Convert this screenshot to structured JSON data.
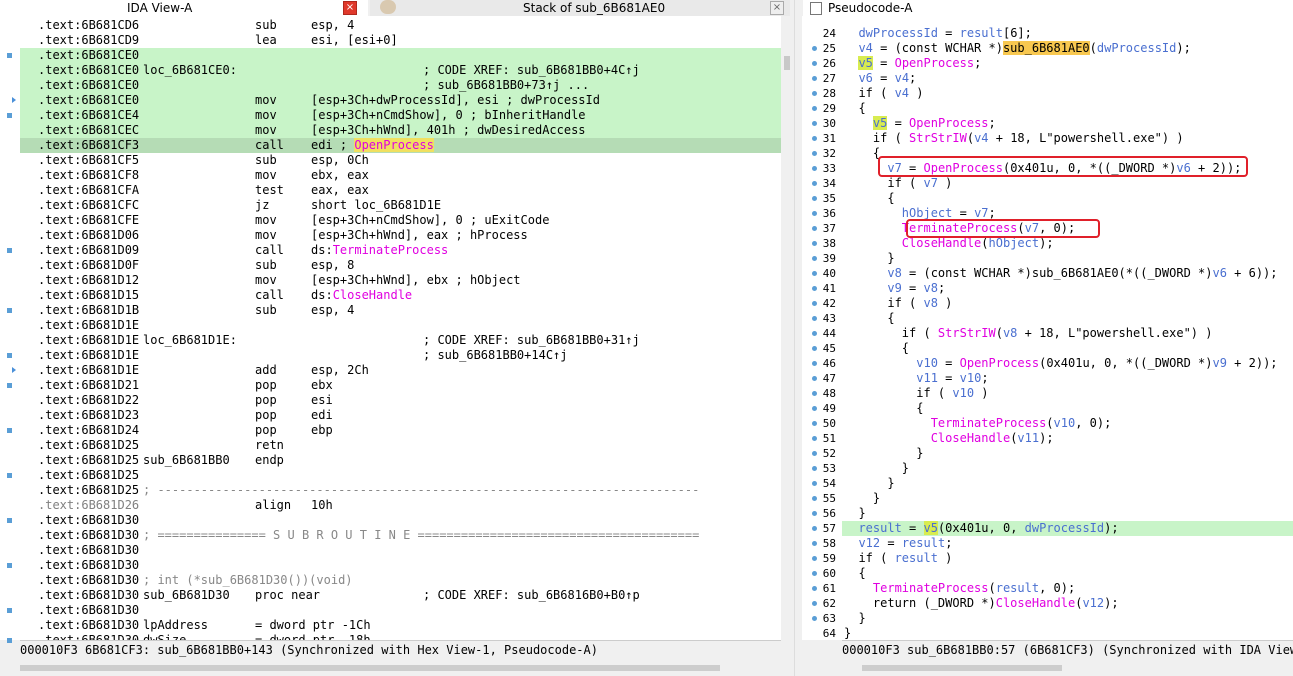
{
  "tabs": {
    "ida_view": "IDA View-A",
    "stack": "Stack of sub_6B681AE0",
    "pseudocode": "Pseudocode-A",
    "close": "×"
  },
  "ida": {
    "rows": [
      {
        "addr": ".text:6B681CD6",
        "label": "",
        "mnem": "sub",
        "ops": "esp, 4",
        "cmt": ""
      },
      {
        "addr": ".text:6B681CD9",
        "label": "",
        "mnem": "lea",
        "ops": "esi, [esi+0]",
        "cmt": ""
      },
      {
        "addr": ".text:6B681CE0",
        "label": "",
        "mnem": "",
        "ops": "",
        "cmt": ""
      },
      {
        "addr": ".text:6B681CE0",
        "label": "loc_6B681CE0:",
        "mnem": "",
        "ops": "",
        "cmt": "; CODE XREF: sub_6B681BB0+4C↑j"
      },
      {
        "addr": ".text:6B681CE0",
        "label": "",
        "mnem": "",
        "ops": "",
        "cmt": "; sub_6B681BB0+73↑j ..."
      },
      {
        "addr": ".text:6B681CE0",
        "label": "",
        "mnem": "mov",
        "ops": "[esp+3Ch+dwProcessId], esi ; dwProcessId",
        "cmt": ""
      },
      {
        "addr": ".text:6B681CE4",
        "label": "",
        "mnem": "mov",
        "ops": "[esp+3Ch+nCmdShow], 0 ; bInheritHandle",
        "cmt": ""
      },
      {
        "addr": ".text:6B681CEC",
        "label": "",
        "mnem": "mov",
        "ops": "[esp+3Ch+hWnd], 401h ; dwDesiredAccess",
        "cmt": ""
      },
      {
        "addr": ".text:6B681CF3",
        "label": "",
        "mnem": "call",
        "ops": "edi ; ",
        "pk": "OpenProcess",
        "cmt": ""
      },
      {
        "addr": ".text:6B681CF5",
        "label": "",
        "mnem": "sub",
        "ops": "esp, 0Ch",
        "cmt": ""
      },
      {
        "addr": ".text:6B681CF8",
        "label": "",
        "mnem": "mov",
        "ops": "ebx, eax",
        "cmt": ""
      },
      {
        "addr": ".text:6B681CFA",
        "label": "",
        "mnem": "test",
        "ops": "eax, eax",
        "cmt": ""
      },
      {
        "addr": ".text:6B681CFC",
        "label": "",
        "mnem": "jz",
        "ops": "short loc_6B681D1E",
        "cmt": ""
      },
      {
        "addr": ".text:6B681CFE",
        "label": "",
        "mnem": "mov",
        "ops": "[esp+3Ch+nCmdShow], 0 ; uExitCode",
        "cmt": ""
      },
      {
        "addr": ".text:6B681D06",
        "label": "",
        "mnem": "mov",
        "ops": "[esp+3Ch+hWnd], eax ; hProcess",
        "cmt": ""
      },
      {
        "addr": ".text:6B681D09",
        "label": "",
        "mnem": "call",
        "ops": "ds:",
        "pk": "TerminateProcess",
        "cmt": ""
      },
      {
        "addr": ".text:6B681D0F",
        "label": "",
        "mnem": "sub",
        "ops": "esp, 8",
        "cmt": ""
      },
      {
        "addr": ".text:6B681D12",
        "label": "",
        "mnem": "mov",
        "ops": "[esp+3Ch+hWnd], ebx ; hObject",
        "cmt": ""
      },
      {
        "addr": ".text:6B681D15",
        "label": "",
        "mnem": "call",
        "ops": "ds:",
        "pk": "CloseHandle",
        "cmt": ""
      },
      {
        "addr": ".text:6B681D1B",
        "label": "",
        "mnem": "sub",
        "ops": "esp, 4",
        "cmt": ""
      },
      {
        "addr": ".text:6B681D1E",
        "label": "",
        "mnem": "",
        "ops": "",
        "cmt": ""
      },
      {
        "addr": ".text:6B681D1E",
        "label": "loc_6B681D1E:",
        "mnem": "",
        "ops": "",
        "cmt": "; CODE XREF: sub_6B681BB0+31↑j"
      },
      {
        "addr": ".text:6B681D1E",
        "label": "",
        "mnem": "",
        "ops": "",
        "cmt": "; sub_6B681BB0+14C↑j"
      },
      {
        "addr": ".text:6B681D1E",
        "label": "",
        "mnem": "add",
        "ops": "esp, 2Ch",
        "cmt": ""
      },
      {
        "addr": ".text:6B681D21",
        "label": "",
        "mnem": "pop",
        "ops": "ebx",
        "cmt": ""
      },
      {
        "addr": ".text:6B681D22",
        "label": "",
        "mnem": "pop",
        "ops": "esi",
        "cmt": ""
      },
      {
        "addr": ".text:6B681D23",
        "label": "",
        "mnem": "pop",
        "ops": "edi",
        "cmt": ""
      },
      {
        "addr": ".text:6B681D24",
        "label": "",
        "mnem": "pop",
        "ops": "ebp",
        "cmt": ""
      },
      {
        "addr": ".text:6B681D25",
        "label": "",
        "mnem": "retn",
        "ops": "",
        "cmt": ""
      },
      {
        "addr": ".text:6B681D25",
        "label": "sub_6B681BB0",
        "mnem": "endp",
        "ops": "",
        "cmt": ""
      },
      {
        "addr": ".text:6B681D25",
        "label": "",
        "mnem": "",
        "ops": "",
        "cmt": ""
      },
      {
        "addr": ".text:6B681D25",
        "label": "",
        "mnem": "",
        "ops": "",
        "cmt": "",
        "gray": "; ---------------------------------------------------------------------------"
      },
      {
        "addr": ".text:6B681D26",
        "label": "",
        "mnem": "align",
        "ops": "10h",
        "cmt": "",
        "addr_gray": true
      },
      {
        "addr": ".text:6B681D30",
        "label": "",
        "mnem": "",
        "ops": "",
        "cmt": ""
      },
      {
        "addr": ".text:6B681D30",
        "label": "",
        "mnem": "",
        "ops": "",
        "cmt": "",
        "gray": "; =============== S U B R O U T I N E ======================================="
      },
      {
        "addr": ".text:6B681D30",
        "label": "",
        "mnem": "",
        "ops": "",
        "cmt": ""
      },
      {
        "addr": ".text:6B681D30",
        "label": "",
        "mnem": "",
        "ops": "",
        "cmt": ""
      },
      {
        "addr": ".text:6B681D30",
        "label": "",
        "mnem": "",
        "ops": "",
        "cmt": "",
        "gray": "; int (*sub_6B681D30())(void)"
      },
      {
        "addr": ".text:6B681D30",
        "label": "sub_6B681D30",
        "mnem": "proc near",
        "ops": "",
        "cmt": "; CODE XREF: sub_6B6816B0+B0↑p"
      },
      {
        "addr": ".text:6B681D30",
        "label": "",
        "mnem": "",
        "ops": "",
        "cmt": ""
      },
      {
        "addr": ".text:6B681D30",
        "label": "lpAddress",
        "mnem": "= dword ptr -1Ch",
        "ops": "",
        "cmt": ""
      },
      {
        "addr": ".text:6B681D30",
        "label": "dwSize",
        "mnem": "= dword ptr -18h",
        "ops": "",
        "cmt": ""
      }
    ],
    "status": "000010F3 6B681CF3: sub_6B681BB0+143 (Synchronized with Hex View-1, Pseudocode-A)"
  },
  "pseudo": {
    "lines": [
      {
        "n": "24",
        "html": "  <span class=\"bl\">dwProcessId</span> = <span class=\"bl\">result</span>[6];"
      },
      {
        "n": "25",
        "html": "  <span class=\"bl\">v4</span> = (const WCHAR *)<span class=\"ybg2\">sub_6B681AE0</span>(<span class=\"bl\">dwProcessId</span>);"
      },
      {
        "n": "26",
        "html": "  <span class=\"ygreen bl\">v5</span> = <span class=\"mg\">OpenProcess</span>;"
      },
      {
        "n": "27",
        "html": "  <span class=\"bl\">v6</span> = <span class=\"bl\">v4</span>;"
      },
      {
        "n": "28",
        "html": "  if ( <span class=\"bl\">v4</span> )"
      },
      {
        "n": "29",
        "html": "  {"
      },
      {
        "n": "30",
        "html": "    <span class=\"ygreen bl\">v5</span> = <span class=\"mg\">OpenProcess</span>;"
      },
      {
        "n": "31",
        "html": "    if ( <span class=\"mg\">StrStrIW</span>(<span class=\"bl\">v4</span> + 18, L\"powershell.exe\") )"
      },
      {
        "n": "32",
        "html": "    {"
      },
      {
        "n": "33",
        "html": "      <span class=\"bl\">v7</span> = <span class=\"mg\">OpenProcess</span>(0x401u, 0, *((_DWORD *)<span class=\"bl\">v6</span> + 2));"
      },
      {
        "n": "34",
        "html": "      if ( <span class=\"bl\">v7</span> )"
      },
      {
        "n": "35",
        "html": "      {"
      },
      {
        "n": "36",
        "html": "        <span class=\"bl\">hObject</span> = <span class=\"bl\">v7</span>;"
      },
      {
        "n": "37",
        "html": "        <span class=\"mg\">TerminateProcess</span>(<span class=\"bl\">v7</span>, 0);"
      },
      {
        "n": "38",
        "html": "        <span class=\"mg\">CloseHandle</span>(<span class=\"bl\">hObject</span>);"
      },
      {
        "n": "39",
        "html": "      }"
      },
      {
        "n": "40",
        "html": "      <span class=\"bl\">v8</span> = (const WCHAR *)sub_6B681AE0(*((_DWORD *)<span class=\"bl\">v6</span> + 6));"
      },
      {
        "n": "41",
        "html": "      <span class=\"bl\">v9</span> = <span class=\"bl\">v8</span>;"
      },
      {
        "n": "42",
        "html": "      if ( <span class=\"bl\">v8</span> )"
      },
      {
        "n": "43",
        "html": "      {"
      },
      {
        "n": "44",
        "html": "        if ( <span class=\"mg\">StrStrIW</span>(<span class=\"bl\">v8</span> + 18, L\"powershell.exe\") )"
      },
      {
        "n": "45",
        "html": "        {"
      },
      {
        "n": "46",
        "html": "          <span class=\"bl\">v10</span> = <span class=\"mg\">OpenProcess</span>(0x401u, 0, *((_DWORD *)<span class=\"bl\">v9</span> + 2));"
      },
      {
        "n": "47",
        "html": "          <span class=\"bl\">v11</span> = <span class=\"bl\">v10</span>;"
      },
      {
        "n": "48",
        "html": "          if ( <span class=\"bl\">v10</span> )"
      },
      {
        "n": "49",
        "html": "          {"
      },
      {
        "n": "50",
        "html": "            <span class=\"mg\">TerminateProcess</span>(<span class=\"bl\">v10</span>, 0);"
      },
      {
        "n": "51",
        "html": "            <span class=\"mg\">CloseHandle</span>(<span class=\"bl\">v11</span>);"
      },
      {
        "n": "52",
        "html": "          }"
      },
      {
        "n": "53",
        "html": "        }"
      },
      {
        "n": "54",
        "html": "      }"
      },
      {
        "n": "55",
        "html": "    }"
      },
      {
        "n": "56",
        "html": "  }"
      },
      {
        "n": "57",
        "html": "  <span class=\"bl\">result</span> = <span class=\"ygreen bl\">v5</span>(0x401u, 0, <span class=\"bl\">dwProcessId</span>);",
        "hl": true
      },
      {
        "n": "58",
        "html": "  <span class=\"bl\">v12</span> = <span class=\"bl\">result</span>;"
      },
      {
        "n": "59",
        "html": "  if ( <span class=\"bl\">result</span> )"
      },
      {
        "n": "60",
        "html": "  {"
      },
      {
        "n": "61",
        "html": "    <span class=\"mg\">TerminateProcess</span>(<span class=\"bl\">result</span>, 0);"
      },
      {
        "n": "62",
        "html": "    return (_DWORD *)<span class=\"mg\">CloseHandle</span>(<span class=\"bl\">v12</span>);"
      },
      {
        "n": "63",
        "html": "  }"
      },
      {
        "n": "64",
        "html": "}"
      }
    ],
    "status": "000010F3 sub_6B681BB0:57 (6B681CF3) (Synchronized with IDA View-"
  }
}
